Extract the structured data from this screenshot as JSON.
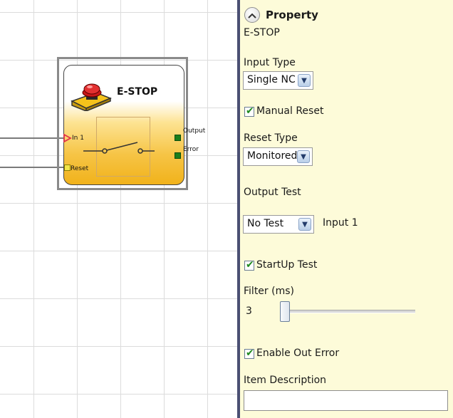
{
  "block": {
    "title": "E-STOP",
    "input_label": "In 1",
    "reset_label": "Reset",
    "output_label": "Output",
    "error_label": "Error"
  },
  "panel": {
    "header": "Property",
    "subtitle": "E-STOP",
    "input_type_label": "Input Type",
    "input_type_value": "Single NC",
    "manual_reset_label": "Manual Reset",
    "manual_reset_checked": true,
    "reset_type_label": "Reset Type",
    "reset_type_value": "Monitored",
    "output_test_label": "Output Test",
    "output_test_value": "No Test",
    "output_test_input": "Input 1",
    "startup_test_label": "StartUp Test",
    "startup_test_checked": true,
    "filter_label": "Filter (ms)",
    "filter_value": "3",
    "enable_out_error_label": "Enable Out Error",
    "enable_out_error_checked": true,
    "item_description_label": "Item Description",
    "item_description_value": ""
  },
  "colors": {
    "panel_bg": "#fdfbd9",
    "divider": "#4a4f73",
    "output_pin": "#1b7e1b",
    "input_arrow": "#e0334a",
    "reset_pin": "#f2e64a"
  }
}
